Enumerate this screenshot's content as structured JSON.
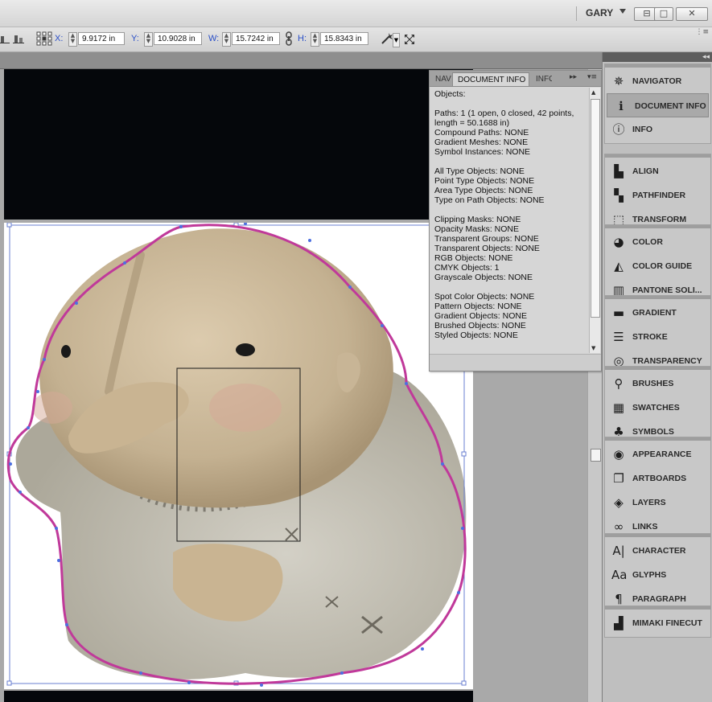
{
  "window": {
    "user_name": "GARY",
    "controls": {
      "minimize": "⊟",
      "maximize": "□",
      "close": "✕"
    }
  },
  "control_bar": {
    "x": {
      "label": "X:",
      "value": "9.9172 in"
    },
    "y": {
      "label": "Y:",
      "value": "10.9028 in"
    },
    "w": {
      "label": "W:",
      "value": "15.7242 in"
    },
    "h": {
      "label": "H:",
      "value": "15.8343 in"
    }
  },
  "document_info_panel": {
    "tabs": [
      {
        "label": "NAV",
        "active": false
      },
      {
        "label": "DOCUMENT INFO",
        "active": true
      },
      {
        "label": "INFO",
        "active": false
      }
    ],
    "heading": "Objects:",
    "groups": [
      [
        "Paths: 1 (1 open, 0 closed, 42 points, length = 50.1688 in)",
        "Compound Paths: NONE",
        "Gradient Meshes: NONE",
        "Symbol Instances: NONE"
      ],
      [
        "All Type Objects: NONE",
        "Point Type Objects: NONE",
        "Area Type Objects: NONE",
        "Type on Path Objects: NONE"
      ],
      [
        "Clipping Masks: NONE",
        "Opacity Masks: NONE",
        "Transparent Groups: NONE",
        "Transparent Objects: NONE",
        "RGB Objects: NONE",
        "CMYK Objects: 1",
        "Grayscale Objects: NONE"
      ],
      [
        "Spot Color Objects: NONE",
        "Pattern Objects: NONE",
        "Gradient Objects: NONE",
        "Brushed Objects: NONE",
        "Styled Objects: NONE"
      ]
    ]
  },
  "dock_groups": [
    {
      "items": [
        {
          "label": "NAVIGATOR",
          "icon": "navigator-icon",
          "glyph": "✵"
        },
        {
          "label": "DOCUMENT INFO",
          "icon": "document-info-icon",
          "glyph": "ℹ",
          "active": true
        },
        {
          "label": "INFO",
          "icon": "info-icon",
          "glyph": "ⓘ"
        }
      ]
    },
    {
      "items": [
        {
          "label": "ALIGN",
          "icon": "align-icon",
          "glyph": "▙"
        },
        {
          "label": "PATHFINDER",
          "icon": "pathfinder-icon",
          "glyph": "▚"
        },
        {
          "label": "TRANSFORM",
          "icon": "transform-icon",
          "glyph": "⬚"
        }
      ]
    },
    {
      "items": [
        {
          "label": "COLOR",
          "icon": "color-icon",
          "glyph": "◕"
        },
        {
          "label": "COLOR GUIDE",
          "icon": "color-guide-icon",
          "glyph": "◭"
        },
        {
          "label": "PANTONE SOLI...",
          "icon": "pantone-icon",
          "glyph": "▥"
        }
      ]
    },
    {
      "items": [
        {
          "label": "GRADIENT",
          "icon": "gradient-icon",
          "glyph": "▬"
        },
        {
          "label": "STROKE",
          "icon": "stroke-icon",
          "glyph": "☰"
        },
        {
          "label": "TRANSPARENCY",
          "icon": "transparency-icon",
          "glyph": "◎"
        }
      ]
    },
    {
      "items": [
        {
          "label": "BRUSHES",
          "icon": "brushes-icon",
          "glyph": "⚲"
        },
        {
          "label": "SWATCHES",
          "icon": "swatches-icon",
          "glyph": "▦"
        },
        {
          "label": "SYMBOLS",
          "icon": "symbols-icon",
          "glyph": "♣"
        }
      ]
    },
    {
      "items": [
        {
          "label": "APPEARANCE",
          "icon": "appearance-icon",
          "glyph": "◉"
        },
        {
          "label": "ARTBOARDS",
          "icon": "artboards-icon",
          "glyph": "❐"
        },
        {
          "label": "LAYERS",
          "icon": "layers-icon",
          "glyph": "◈"
        },
        {
          "label": "LINKS",
          "icon": "links-icon",
          "glyph": "∞"
        }
      ]
    },
    {
      "items": [
        {
          "label": "CHARACTER",
          "icon": "character-icon",
          "glyph": "A|"
        },
        {
          "label": "GLYPHS",
          "icon": "glyphs-icon",
          "glyph": "Aa"
        },
        {
          "label": "PARAGRAPH",
          "icon": "paragraph-icon",
          "glyph": "¶"
        }
      ]
    },
    {
      "items": [
        {
          "label": "MIMAKI FINECUT",
          "icon": "mimaki-finecut-icon",
          "glyph": "▟"
        }
      ]
    }
  ],
  "colors": {
    "selection_path": "#c0399a",
    "anchor_points": "#4d6fe0",
    "selection_box": "#6a7fd0",
    "label_blue": "#2a4fc8"
  }
}
